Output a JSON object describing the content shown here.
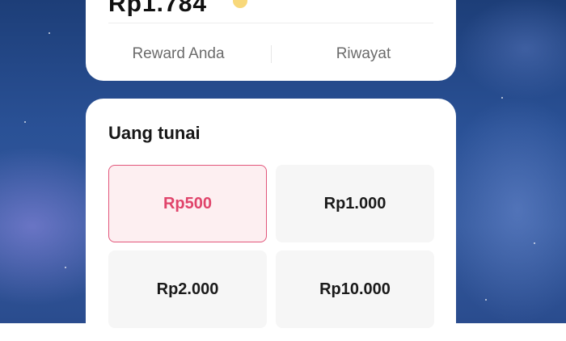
{
  "top_card": {
    "balance": "Rp1.784",
    "tabs": [
      {
        "label": "Reward Anda"
      },
      {
        "label": "Riwayat"
      }
    ]
  },
  "cash_card": {
    "title": "Uang tunai",
    "options": [
      {
        "label": "Rp500",
        "selected": true
      },
      {
        "label": "Rp1.000",
        "selected": false
      },
      {
        "label": "Rp2.000",
        "selected": false
      },
      {
        "label": "Rp10.000",
        "selected": false
      }
    ]
  },
  "colors": {
    "accent": "#e0446b",
    "selected_bg": "#fdeff1",
    "option_bg": "#f6f6f6",
    "coin": "#f5c842"
  },
  "icons": [
    "coin-icon"
  ]
}
